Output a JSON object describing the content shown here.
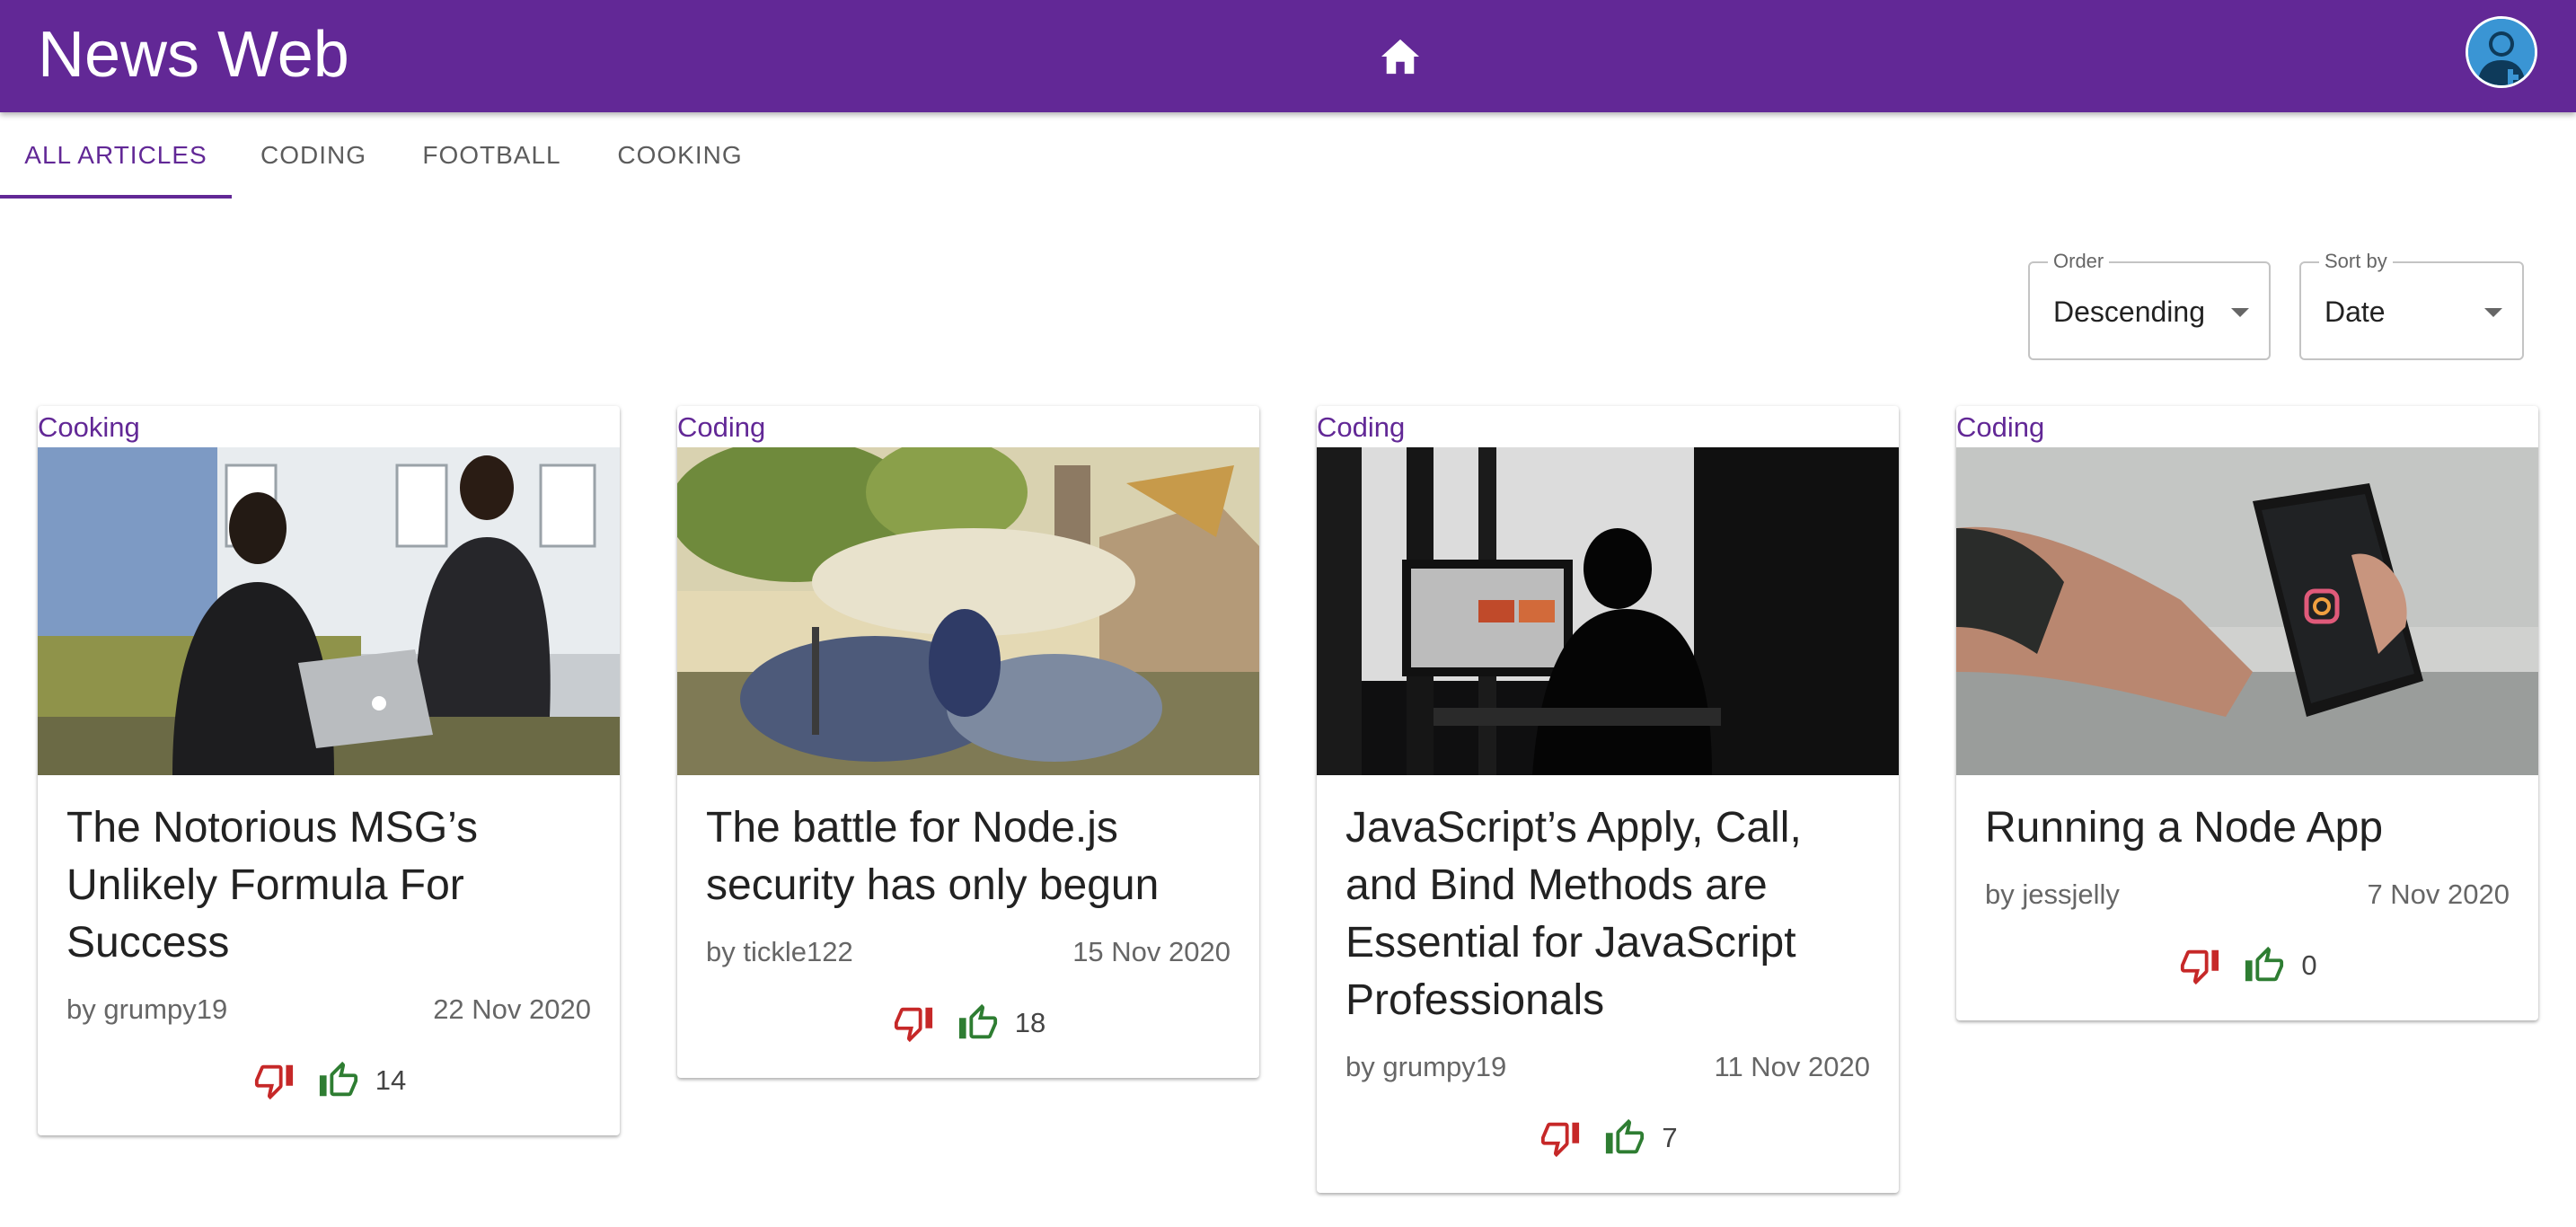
{
  "app": {
    "title": "News Web",
    "brand_color": "#622896"
  },
  "nav": {
    "home_icon": "home-icon",
    "avatar_icon": "account-avatar-icon"
  },
  "tabs": [
    {
      "label": "ALL ARTICLES",
      "active": true
    },
    {
      "label": "CODING",
      "active": false
    },
    {
      "label": "FOOTBALL",
      "active": false
    },
    {
      "label": "COOKING",
      "active": false
    }
  ],
  "filters": {
    "order": {
      "label": "Order",
      "value": "Descending"
    },
    "sort_by": {
      "label": "Sort by",
      "value": "Date"
    }
  },
  "articles": [
    {
      "category": "Cooking",
      "title": "The Notorious MSG’s Unlikely Formula For Success",
      "author": "by grumpy19",
      "date": "22 Nov 2020",
      "votes": "14"
    },
    {
      "category": "Coding",
      "title": "The battle for Node.js security has only begun",
      "author": "by tickle122",
      "date": "15 Nov 2020",
      "votes": "18"
    },
    {
      "category": "Coding",
      "title": "JavaScript’s Apply, Call, and Bind Methods are Essential for JavaScript Professionals",
      "author": "by grumpy19",
      "date": "11 Nov 2020",
      "votes": "7"
    },
    {
      "category": "Coding",
      "title": "Running a Node App",
      "author": "by jessjelly",
      "date": "7 Nov 2020",
      "votes": "0"
    }
  ],
  "colors": {
    "downvote": "#c62828",
    "upvote": "#2e7d32"
  }
}
